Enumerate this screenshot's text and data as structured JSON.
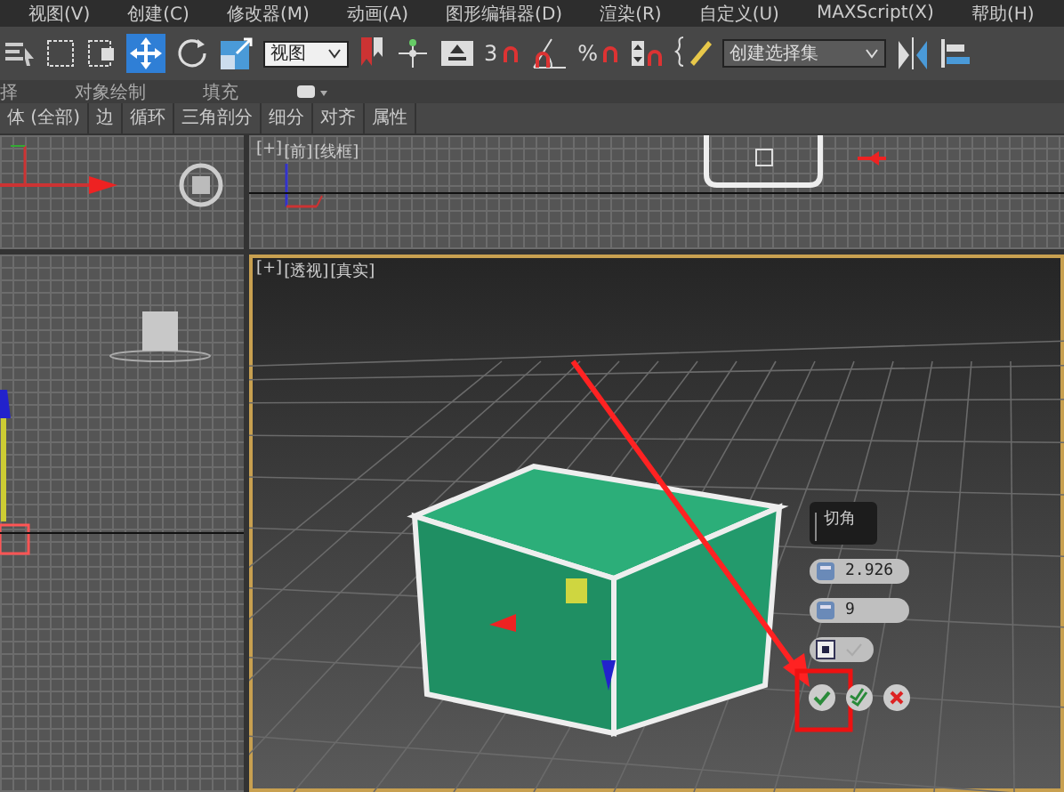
{
  "menu": [
    "视图(V)",
    "创建(C)",
    "修改器(M)",
    "动画(A)",
    "图形编辑器(D)",
    "渲染(R)",
    "自定义(U)",
    "MAXScript(X)",
    "帮助(H)"
  ],
  "toolbar": {
    "view_dropdown": "视图",
    "snap_label": "3",
    "percent_label": "%",
    "selection_set": "创建选择集"
  },
  "ribbon_tabs": [
    {
      "label": "择"
    },
    {
      "label": "对象绘制"
    },
    {
      "label": "填充"
    }
  ],
  "ribbon_panels": [
    "体 (全部)",
    "边",
    "循环",
    "三角剖分",
    "细分",
    "对齐",
    "属性"
  ],
  "front_viewport": {
    "labels": [
      "[+]",
      "[前]",
      "[线框]"
    ],
    "active": false
  },
  "perspective_viewport": {
    "labels": [
      "[+]",
      "[透视]",
      "[真实]"
    ],
    "active": true
  },
  "chamfer_caddy": {
    "title": "切角",
    "fields": [
      "2.926",
      "9"
    ]
  }
}
